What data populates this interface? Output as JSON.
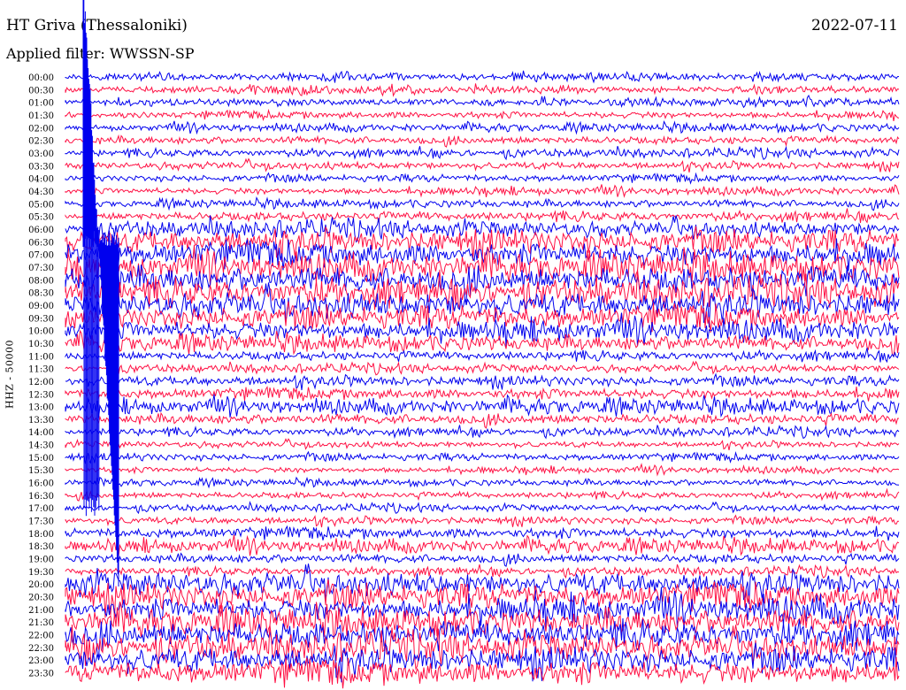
{
  "header": {
    "station": "HT Griva (Thessaloniki)",
    "date": "2022-07-11",
    "filter_label": "Applied filter: WWSSN-SP"
  },
  "channel_label": "HHZ - 50000",
  "hour_labels": [
    "00:00",
    "00:30",
    "01:00",
    "01:30",
    "02:00",
    "02:30",
    "03:00",
    "03:30",
    "04:00",
    "04:30",
    "05:00",
    "05:30",
    "06:00",
    "06:30",
    "07:00",
    "07:30",
    "08:00",
    "08:30",
    "09:00",
    "09:30",
    "10:00",
    "10:30",
    "11:00",
    "11:30",
    "12:00",
    "12:30",
    "13:00",
    "13:30",
    "14:00",
    "14:30",
    "15:00",
    "15:30",
    "16:00",
    "16:30",
    "17:00",
    "17:30",
    "18:00",
    "18:30",
    "19:00",
    "19:30",
    "20:00",
    "20:30",
    "21:00",
    "21:30",
    "22:00",
    "22:30",
    "23:00",
    "23:30"
  ],
  "traces": {
    "colors": [
      "#0000ee",
      "#ff1144"
    ],
    "amplitude_level": [
      0.3,
      0.3,
      0.3,
      0.3,
      0.3,
      0.3,
      0.3,
      0.3,
      0.3,
      0.3,
      0.3,
      0.35,
      0.6,
      0.9,
      1.0,
      1.0,
      1.0,
      1.0,
      1.0,
      0.95,
      0.8,
      0.6,
      0.35,
      0.3,
      0.4,
      0.45,
      0.55,
      0.4,
      0.3,
      0.25,
      0.3,
      0.25,
      0.25,
      0.25,
      0.25,
      0.3,
      0.45,
      0.5,
      0.35,
      0.3,
      0.9,
      1.0,
      1.0,
      1.0,
      1.0,
      1.0,
      1.0,
      1.0
    ]
  }
}
